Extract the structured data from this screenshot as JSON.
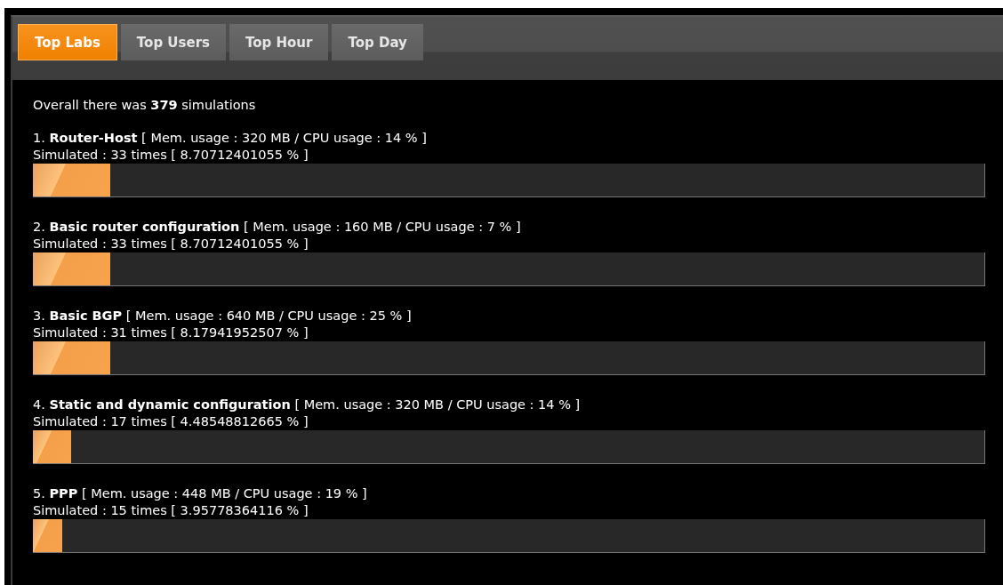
{
  "tabs": [
    {
      "label": "Top Labs",
      "selected": true
    },
    {
      "label": "Top Users",
      "selected": false
    },
    {
      "label": "Top Hour",
      "selected": false
    },
    {
      "label": "Top Day",
      "selected": false
    }
  ],
  "summary": "Overall there was **379** simulations",
  "labs": [
    {
      "title": "1. **Router-Host** [ Mem. usage : 320 MB / CPU usage : 14 % ]",
      "simulated": "Simulated : 33 times [ 8.70712401055 % ]",
      "level": 0.081
    },
    {
      "title": "2. **Basic router configuration** [ Mem. usage : 160 MB / CPU usage : 7 % ]",
      "simulated": "Simulated : 33 times [ 8.70712401055 % ]",
      "level": 0.081
    },
    {
      "title": "3. **Basic BGP** [ Mem. usage : 640 MB / CPU usage : 25 % ]",
      "simulated": "Simulated : 31 times [ 8.17941952507 % ]",
      "level": 0.081
    },
    {
      "title": "4. **Static and dynamic configuration** [ Mem. usage : 320 MB / CPU usage : 14 % ]",
      "simulated": "Simulated : 17 times [ 4.48548812665 % ]",
      "level": 0.04
    },
    {
      "title": "5. **PPP** [ Mem. usage : 448 MB / CPU usage : 19 % ]",
      "simulated": "Simulated : 15 times [ 3.95778364116 % ]",
      "level": 0.031
    }
  ]
}
